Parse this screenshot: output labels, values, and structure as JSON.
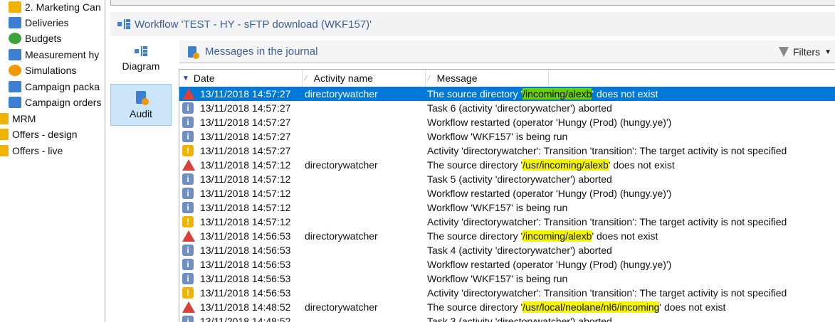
{
  "tree": [
    {
      "label": "2. Marketing Can",
      "icon": "folder-gear-icon",
      "color": "#f0b400"
    },
    {
      "label": "Deliveries",
      "icon": "envelope-icon",
      "color": "#3d7fd0"
    },
    {
      "label": "Budgets",
      "icon": "calculator-icon",
      "color": "#3aa43a"
    },
    {
      "label": "Measurement hy",
      "icon": "gauge-icon",
      "color": "#3d7fd0"
    },
    {
      "label": "Simulations",
      "icon": "play-icon",
      "color": "#f09a00"
    },
    {
      "label": "Campaign packa",
      "icon": "package-icon",
      "color": "#3d7fd0"
    },
    {
      "label": "Campaign orders",
      "icon": "order-icon",
      "color": "#3d7fd0"
    },
    {
      "label": "MRM",
      "icon": "folder-gear-icon",
      "color": "#f0b400"
    },
    {
      "label": "Offers - design",
      "icon": "offer-icon",
      "color": "#f0b400"
    },
    {
      "label": "Offers - live",
      "icon": "offer-icon",
      "color": "#f0b400"
    }
  ],
  "workflow_title": "Workflow 'TEST - HY - sFTP download (WKF157)'",
  "side": {
    "diagram": "Diagram",
    "audit": "Audit"
  },
  "toolbar": {
    "title": "Messages in the journal",
    "filters": "Filters"
  },
  "columns": {
    "date": "Date",
    "activity": "Activity name",
    "message": "Message"
  },
  "rows": [
    {
      "type": "error",
      "date": "13/11/2018 14:57:27",
      "activity": "directorywatcher",
      "pre": "The source directory '",
      "hl": "/incoming/alexb",
      "post": "' does not exist",
      "selected": true
    },
    {
      "type": "info",
      "date": "13/11/2018 14:57:27",
      "activity": "",
      "pre": "Task 6 (activity 'directorywatcher') aborted"
    },
    {
      "type": "info",
      "date": "13/11/2018 14:57:27",
      "activity": "",
      "pre": "Workflow restarted (operator 'Hungy (Prod) (hungy.ye)')"
    },
    {
      "type": "info",
      "date": "13/11/2018 14:57:27",
      "activity": "",
      "pre": "Workflow 'WKF157' is being run"
    },
    {
      "type": "warning",
      "date": "13/11/2018 14:57:27",
      "activity": "",
      "pre": "Activity 'directorywatcher': Transition 'transition': The target activity is not specified"
    },
    {
      "type": "error",
      "date": "13/11/2018 14:57:12",
      "activity": "directorywatcher",
      "pre": "The source directory '",
      "hl": "/usr/incoming/alexb",
      "post": "' does not exist"
    },
    {
      "type": "info",
      "date": "13/11/2018 14:57:12",
      "activity": "",
      "pre": "Task 5 (activity 'directorywatcher') aborted"
    },
    {
      "type": "info",
      "date": "13/11/2018 14:57:12",
      "activity": "",
      "pre": "Workflow restarted (operator 'Hungy (Prod) (hungy.ye)')"
    },
    {
      "type": "info",
      "date": "13/11/2018 14:57:12",
      "activity": "",
      "pre": "Workflow 'WKF157' is being run"
    },
    {
      "type": "warning",
      "date": "13/11/2018 14:57:12",
      "activity": "",
      "pre": "Activity 'directorywatcher': Transition 'transition': The target activity is not specified"
    },
    {
      "type": "error",
      "date": "13/11/2018 14:56:53",
      "activity": "directorywatcher",
      "pre": "The source directory '",
      "hl": "/incoming/alexb",
      "post": "' does not exist"
    },
    {
      "type": "info",
      "date": "13/11/2018 14:56:53",
      "activity": "",
      "pre": "Task 4 (activity 'directorywatcher') aborted"
    },
    {
      "type": "info",
      "date": "13/11/2018 14:56:53",
      "activity": "",
      "pre": "Workflow restarted (operator 'Hungy (Prod) (hungy.ye)')"
    },
    {
      "type": "info",
      "date": "13/11/2018 14:56:53",
      "activity": "",
      "pre": "Workflow 'WKF157' is being run"
    },
    {
      "type": "warning",
      "date": "13/11/2018 14:56:53",
      "activity": "",
      "pre": "Activity 'directorywatcher': Transition 'transition': The target activity is not specified"
    },
    {
      "type": "error",
      "date": "13/11/2018 14:48:52",
      "activity": "directorywatcher",
      "pre": "The source directory '",
      "hl": "/usr/local/neolane/nl6/incoming",
      "post": "' does not exist"
    },
    {
      "type": "info",
      "date": "13/11/2018 14:48:52",
      "activity": "",
      "pre": "Task 3 (activity 'directorywatcher') aborted"
    }
  ]
}
